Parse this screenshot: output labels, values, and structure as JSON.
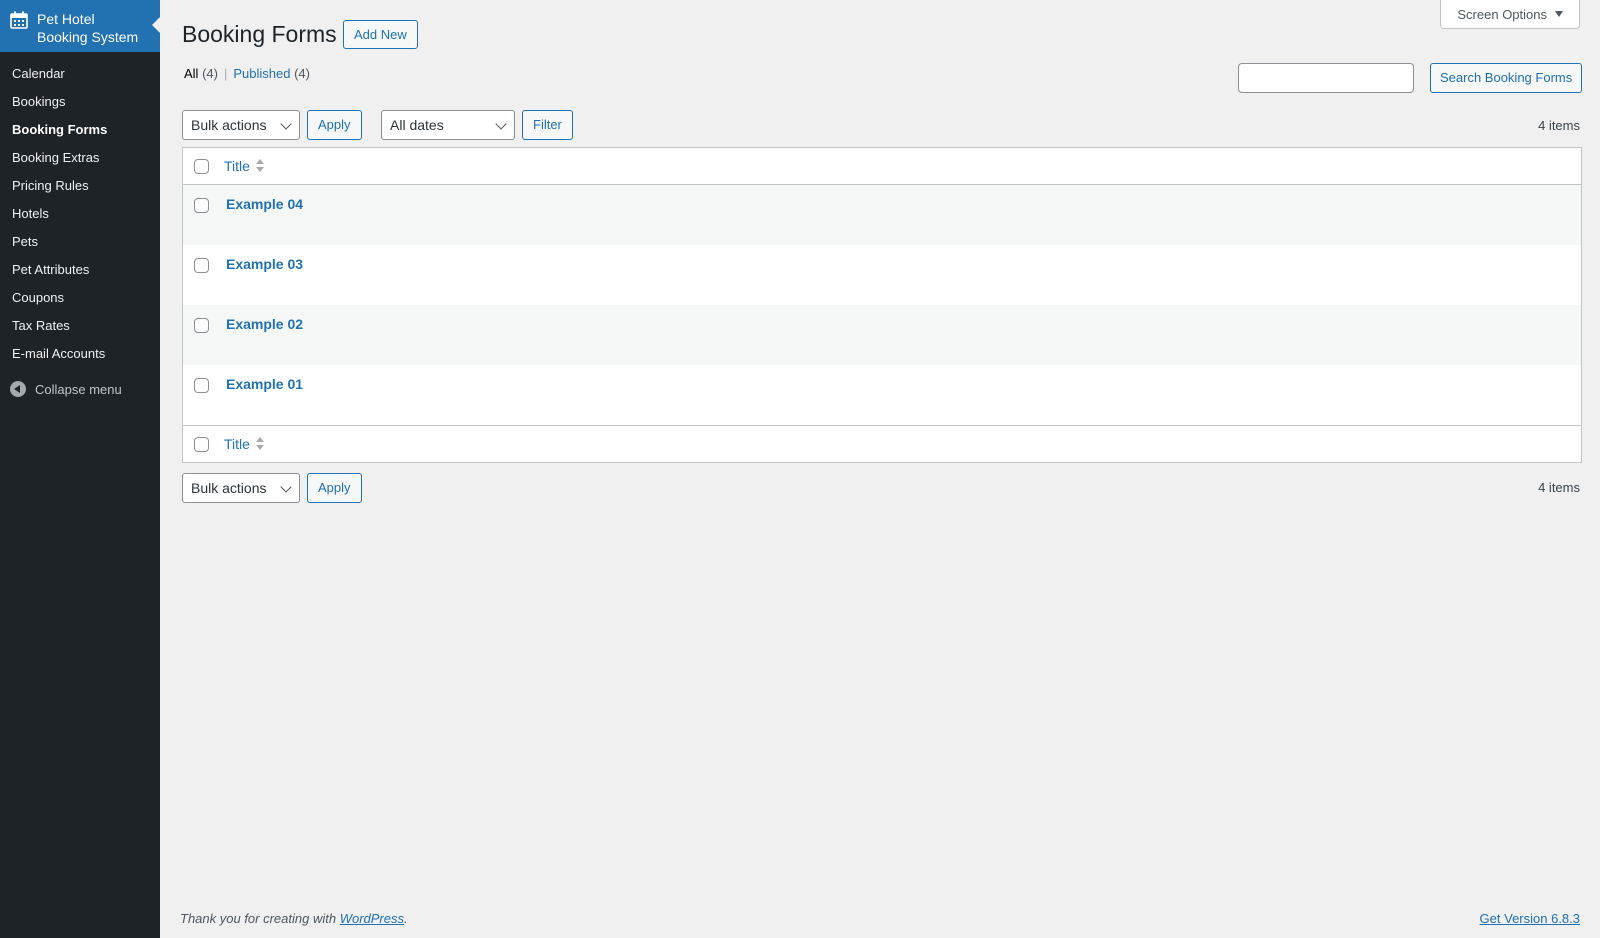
{
  "sidebar": {
    "brand_title": "Pet Hotel Booking System",
    "brand_icon": "calendar-icon",
    "items": [
      {
        "label": "Calendar"
      },
      {
        "label": "Bookings"
      },
      {
        "label": "Booking Forms",
        "current": true
      },
      {
        "label": "Booking Extras"
      },
      {
        "label": "Pricing Rules"
      },
      {
        "label": "Hotels"
      },
      {
        "label": "Pets"
      },
      {
        "label": "Pet Attributes"
      },
      {
        "label": "Coupons"
      },
      {
        "label": "Tax Rates"
      },
      {
        "label": "E-mail Accounts"
      }
    ],
    "collapse_label": "Collapse menu"
  },
  "header": {
    "screen_options": "Screen Options",
    "title": "Booking Forms",
    "add_new": "Add New"
  },
  "views": {
    "all_label": "All",
    "all_count": "(4)",
    "separator": "|",
    "published_label": "Published",
    "published_count": "(4)"
  },
  "search": {
    "value": "",
    "button": "Search Booking Forms"
  },
  "tablenav_top": {
    "bulk_actions": "Bulk actions",
    "apply": "Apply",
    "dates": "All dates",
    "filter": "Filter",
    "items": "4 items"
  },
  "table": {
    "column_title": "Title",
    "rows": [
      {
        "title": "Example 04"
      },
      {
        "title": "Example 03"
      },
      {
        "title": "Example 02"
      },
      {
        "title": "Example 01"
      }
    ]
  },
  "tablenav_bottom": {
    "bulk_actions": "Bulk actions",
    "apply": "Apply",
    "items": "4 items"
  },
  "footer": {
    "thanks_prefix": "Thank you for creating with ",
    "wordpress": "WordPress",
    "thanks_suffix": ".",
    "version": "Get Version 6.8.3"
  },
  "colors": {
    "sidebar_bg": "#1d2327",
    "accent": "#2271b1",
    "page_bg": "#f0f0f1"
  }
}
